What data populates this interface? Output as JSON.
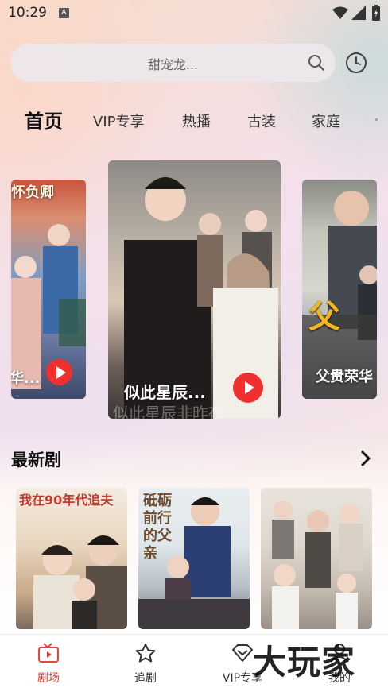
{
  "status_bar": {
    "time": "10:29",
    "notification_icon": "A"
  },
  "search": {
    "placeholder": "甜宠龙..."
  },
  "tabs": [
    {
      "label": "首页",
      "active": true
    },
    {
      "label": "VIP专享"
    },
    {
      "label": "热播"
    },
    {
      "label": "古装"
    },
    {
      "label": "家庭"
    }
  ],
  "carousel": [
    {
      "title": "华...",
      "poster_text": "怀负卿"
    },
    {
      "title": "似此星辰...",
      "poster_text": "似此星辰非昨夜"
    },
    {
      "title": "父贵荣华",
      "poster_text": "父贵荣华"
    }
  ],
  "latest": {
    "title": "最新剧",
    "items": [
      {
        "poster_text": "我在90年代追夫"
      },
      {
        "poster_text": "砥砺前行的父亲"
      },
      {
        "poster_text": ""
      }
    ]
  },
  "bottom_nav": [
    {
      "label": "剧场",
      "icon": "theater-icon",
      "active": true
    },
    {
      "label": "追剧",
      "icon": "star-icon"
    },
    {
      "label": "VIP专享",
      "icon": "diamond-icon"
    },
    {
      "label": "我的",
      "icon": "user-icon"
    }
  ],
  "watermark": "大玩家",
  "colors": {
    "accent": "#e8453c",
    "play": "#f0302e"
  }
}
